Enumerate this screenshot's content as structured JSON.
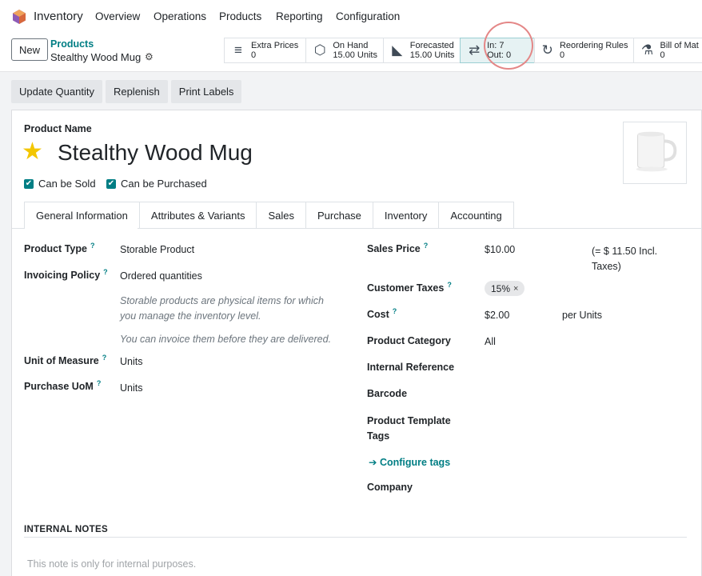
{
  "app": {
    "name": "Inventory",
    "menu": [
      "Overview",
      "Operations",
      "Products",
      "Reporting",
      "Configuration"
    ]
  },
  "controls": {
    "new_label": "New",
    "breadcrumb_parent": "Products",
    "breadcrumb_current": "Stealthy Wood Mug"
  },
  "smart_buttons": [
    {
      "icon": "list-icon",
      "glyph": "≡",
      "line1": "Extra Prices",
      "line2": "0"
    },
    {
      "icon": "cubes-icon",
      "glyph": "⬡",
      "line1": "On Hand",
      "line2": "15.00 Units"
    },
    {
      "icon": "area-chart-icon",
      "glyph": "◣",
      "line1": "Forecasted",
      "line2": "15.00 Units"
    },
    {
      "icon": "exchange-icon",
      "glyph": "⇄",
      "line1": "In: 7",
      "line2": "Out: 0"
    },
    {
      "icon": "refresh-icon",
      "glyph": "↻",
      "line1": "Reordering Rules",
      "line2": "0"
    },
    {
      "icon": "flask-icon",
      "glyph": "⚗",
      "line1": "Bill of Mat",
      "line2": "0"
    }
  ],
  "actions": {
    "update_qty": "Update Quantity",
    "replenish": "Replenish",
    "print_labels": "Print Labels"
  },
  "product": {
    "name_label": "Product Name",
    "name": "Stealthy Wood Mug",
    "can_be_sold": "Can be Sold",
    "can_be_purchased": "Can be Purchased"
  },
  "tabs": [
    "General Information",
    "Attributes & Variants",
    "Sales",
    "Purchase",
    "Inventory",
    "Accounting"
  ],
  "general": {
    "product_type_label": "Product Type",
    "product_type": "Storable Product",
    "invoicing_policy_label": "Invoicing Policy",
    "invoicing_policy": "Ordered quantities",
    "help1a": "Storable products are physical items for which",
    "help1b": "you manage the inventory level.",
    "help2": "You can invoice them before they are delivered.",
    "uom_label": "Unit of Measure",
    "uom": "Units",
    "purchase_uom_label": "Purchase UoM",
    "purchase_uom": "Units",
    "help_mark": "?",
    "sales_price_label": "Sales Price",
    "sales_price": "$10.00",
    "incl_taxes_a": "(= $ 11.50 Incl.",
    "incl_taxes_b": "Taxes)",
    "customer_taxes_label": "Customer Taxes",
    "tax_badge": "15%",
    "tax_remove": "×",
    "cost_label": "Cost",
    "cost": "$2.00",
    "cost_unit": "per Units",
    "category_label": "Product Category",
    "category": "All",
    "internal_ref_label": "Internal Reference",
    "barcode_label": "Barcode",
    "tags_label_a": "Product Template",
    "tags_label_b": "Tags",
    "configure_tags": "➔ Configure tags",
    "company_label": "Company"
  },
  "notes": {
    "title": "INTERNAL NOTES",
    "placeholder": "This note is only for internal purposes."
  },
  "colors": {
    "accent": "#017e84",
    "star": "#f3c600"
  }
}
